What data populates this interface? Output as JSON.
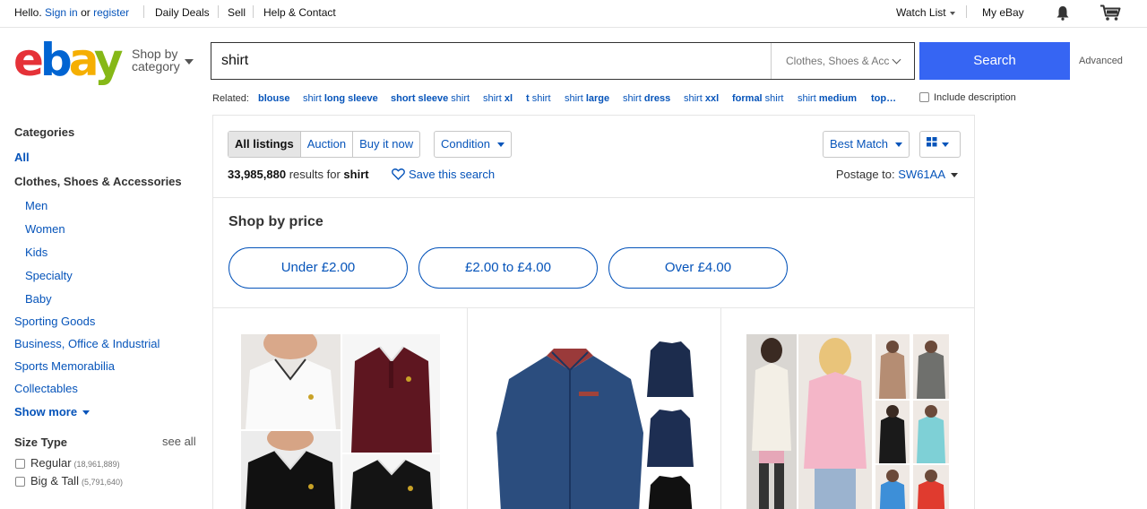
{
  "topbar": {
    "hello": "Hello.",
    "sign_in": "Sign in",
    "or": "or",
    "register": "register",
    "daily_deals": "Daily Deals",
    "sell": "Sell",
    "help": "Help & Contact",
    "watch_list": "Watch List",
    "my_ebay": "My eBay",
    "icons": [
      "bell-icon",
      "cart-icon"
    ]
  },
  "header": {
    "logo": {
      "e": "e",
      "b": "b",
      "a": "a",
      "y": "y"
    },
    "shop_by": "Shop by",
    "category": "category",
    "search_value": "shirt",
    "category_select": "Clothes, Shoes & Acc",
    "search_button": "Search",
    "advanced": "Advanced"
  },
  "related": {
    "label": "Related:",
    "items": [
      {
        "pre": "",
        "bold": "blouse",
        "post": ""
      },
      {
        "pre": "shirt ",
        "bold": "long sleeve",
        "post": ""
      },
      {
        "pre": "",
        "bold": "short sleeve",
        "post": " shirt"
      },
      {
        "pre": "shirt ",
        "bold": "xl",
        "post": ""
      },
      {
        "pre": "",
        "bold": "t",
        "post": " shirt"
      },
      {
        "pre": "shirt ",
        "bold": "large",
        "post": ""
      },
      {
        "pre": "shirt ",
        "bold": "dress",
        "post": ""
      },
      {
        "pre": "shirt ",
        "bold": "xxl",
        "post": ""
      },
      {
        "pre": "",
        "bold": "formal",
        "post": " shirt"
      },
      {
        "pre": "shirt ",
        "bold": "medium",
        "post": ""
      },
      {
        "pre": "",
        "bold": "top…",
        "post": ""
      }
    ],
    "include_description": "Include description"
  },
  "sidebar": {
    "categories_heading": "Categories",
    "all": "All",
    "main_category": "Clothes, Shoes & Accessories",
    "subcategories": [
      "Men",
      "Women",
      "Kids",
      "Specialty",
      "Baby"
    ],
    "other_categories": [
      "Sporting Goods",
      "Business, Office & Industrial",
      "Sports Memorabilia",
      "Collectables"
    ],
    "show_more": "Show more",
    "size_type_heading": "Size Type",
    "see_all": "see all",
    "size_types": [
      {
        "label": "Regular",
        "count": "(18,961,889)"
      },
      {
        "label": "Big & Tall",
        "count": "(5,791,640)"
      }
    ]
  },
  "results": {
    "tabs": [
      "All listings",
      "Auction",
      "Buy it now"
    ],
    "selected_tab": "All listings",
    "condition": "Condition",
    "sort": "Best Match",
    "view_icon": "grid-view-icon",
    "count": "33,985,880",
    "results_for": "results for",
    "query": "shirt",
    "save_search": "Save this search",
    "postage_to": "Postage to:",
    "postcode": "SW61AA",
    "shop_by_price": "Shop by price",
    "price_buttons": [
      "Under £2.00",
      "£2.00 to £4.00",
      "Over £4.00"
    ]
  },
  "colors": {
    "link": "#0654ba",
    "search_button": "#3665f3",
    "logo_e": "#e53238",
    "logo_b": "#0064d2",
    "logo_a": "#f5af02",
    "logo_y": "#86b817"
  }
}
